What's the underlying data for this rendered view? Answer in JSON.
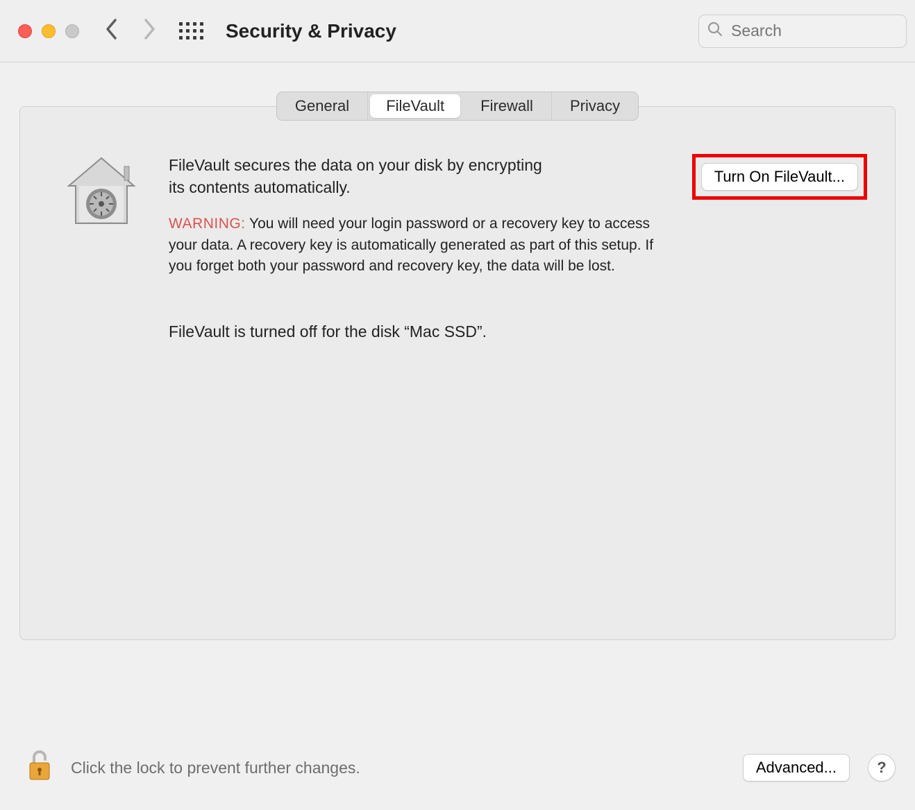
{
  "toolbar": {
    "title": "Security & Privacy",
    "search_placeholder": "Search"
  },
  "tabs": {
    "items": [
      "General",
      "FileVault",
      "Firewall",
      "Privacy"
    ],
    "active_index": 1
  },
  "content": {
    "description": "FileVault secures the data on your disk by encrypting its contents automatically.",
    "turn_on_label": "Turn On FileVault...",
    "warning_label": "WARNING:",
    "warning_text": "You will need your login password or a recovery key to access your data. A recovery key is automatically generated as part of this setup. If you forget both your password and recovery key, the data will be lost.",
    "status_text": "FileVault is turned off for the disk “Mac SSD”."
  },
  "footer": {
    "lock_text": "Click the lock to prevent further changes.",
    "advanced_label": "Advanced...",
    "help_label": "?"
  },
  "colors": {
    "highlight": "#ef0000",
    "warning_text": "#d9534f"
  }
}
